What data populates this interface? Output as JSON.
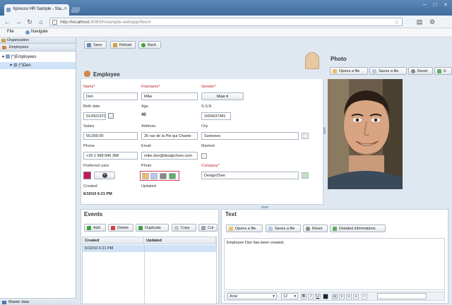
{
  "browser": {
    "tab_title": "Xpresso HR Sample - Sta...",
    "url_host": "http://localhost",
    "url_path": ":8080/hrsample-webapp/flex/#"
  },
  "apptoolbar": {
    "file": "File",
    "navigate": "Navigate"
  },
  "tree": {
    "header": "Organization",
    "items": [
      {
        "label": "Employees"
      },
      {
        "label": "(*)Employees"
      },
      {
        "label": "(*)Den"
      }
    ],
    "footer": "Master data"
  },
  "toolbar": {
    "save": "Save",
    "reload": "Reload",
    "back": "Back"
  },
  "employee": {
    "title": "Employee",
    "labels": {
      "name": "Name*",
      "firstname": "Firstname*",
      "gender": "Gender*",
      "birth": "Birth date",
      "age": "Age",
      "ssn": "S.S.N",
      "salary": "Salary",
      "address": "Address",
      "city": "City",
      "phone": "Phone",
      "email": "Email",
      "married": "Married",
      "color": "Preferred color",
      "photo": "Photo",
      "company": "Company*",
      "created": "Created",
      "updated": "Updated"
    },
    "values": {
      "name": "Den",
      "firstname": "Mike",
      "gender": "Male",
      "birth": "01/05/1970",
      "age": "40",
      "ssn": "1659637481",
      "salary": "60,000.00",
      "address": "26 rue de la Pie qui Chante",
      "city": "Suresnes",
      "phone": "+33 1 968 846 398",
      "email": "mike.den@design2see.com",
      "company": "Design2See",
      "created": "6/10/10 6:21 PM"
    }
  },
  "photo_panel": {
    "title": "Photo",
    "open": "Opens a file",
    "save": "Saves a file",
    "reset": "Reset",
    "ok": "D"
  },
  "events": {
    "title": "Events",
    "add": "Add",
    "delete": "Delete",
    "duplicate": "Duplicate",
    "copy": "Copy",
    "cut": "Cut",
    "columns": [
      "Created",
      "Updated"
    ],
    "rows": [
      {
        "created": "6/10/10 6:21 PM",
        "updated": ""
      }
    ]
  },
  "text_panel": {
    "title": "Text",
    "open": "Opens a file",
    "save": "Saves a file",
    "reset": "Reset",
    "details": "Detailed informations",
    "content": "Employee Den has been created.",
    "font": "Arial",
    "size": "12"
  }
}
